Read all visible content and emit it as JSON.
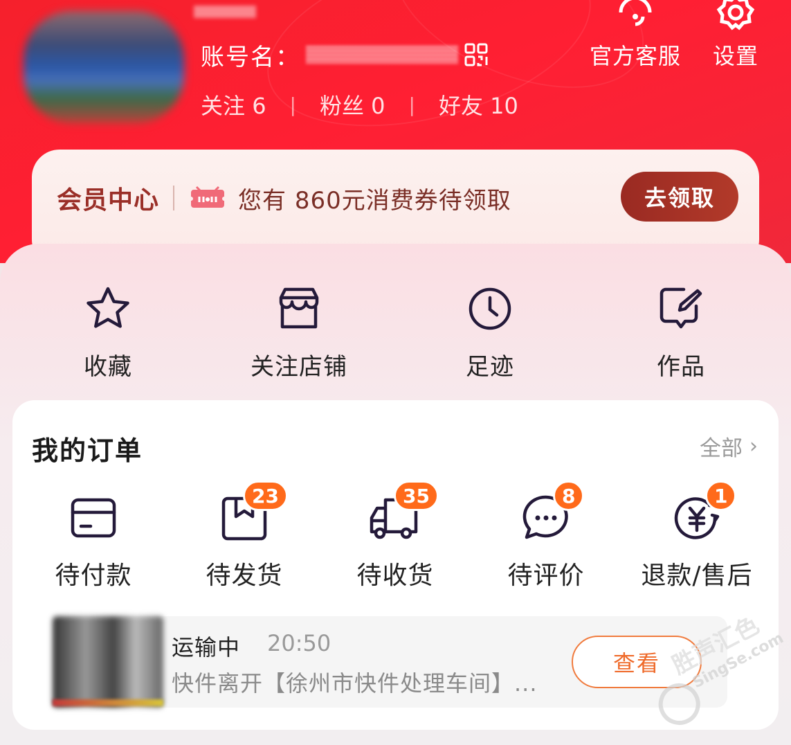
{
  "header": {
    "account_label": "账号名：",
    "stats": [
      {
        "label": "关注",
        "count": "6"
      },
      {
        "label": "粉丝",
        "count": "0"
      },
      {
        "label": "好友",
        "count": "10"
      }
    ],
    "service_label": "官方客服",
    "settings_label": "设置"
  },
  "member": {
    "title": "会员中心",
    "coupon_text": "您有 860元消费券待领取",
    "claim_label": "去领取"
  },
  "quick_links": [
    {
      "label": "收藏",
      "icon": "star-icon"
    },
    {
      "label": "关注店铺",
      "icon": "store-icon"
    },
    {
      "label": "足迹",
      "icon": "clock-icon"
    },
    {
      "label": "作品",
      "icon": "edit-icon"
    }
  ],
  "orders": {
    "title": "我的订单",
    "all_label": "全部",
    "items": [
      {
        "label": "待付款",
        "icon": "card-icon",
        "badge": ""
      },
      {
        "label": "待发货",
        "icon": "package-icon",
        "badge": "23"
      },
      {
        "label": "待收货",
        "icon": "truck-icon",
        "badge": "35"
      },
      {
        "label": "待评价",
        "icon": "chat-icon",
        "badge": "8"
      },
      {
        "label": "退款/售后",
        "icon": "refund-icon",
        "badge": "1"
      }
    ]
  },
  "shipment": {
    "status": "运输中",
    "time": "20:50",
    "description": "快件离开【徐州市快件处理车间】...",
    "view_label": "查看"
  },
  "watermark": {
    "cn": "胜声汇色",
    "en": "SingSe.com"
  },
  "colors": {
    "header_red": "#f5202c",
    "member_brown": "#9a2f28",
    "badge_orange": "#ff6a1a",
    "view_orange": "#ef6a2a"
  }
}
